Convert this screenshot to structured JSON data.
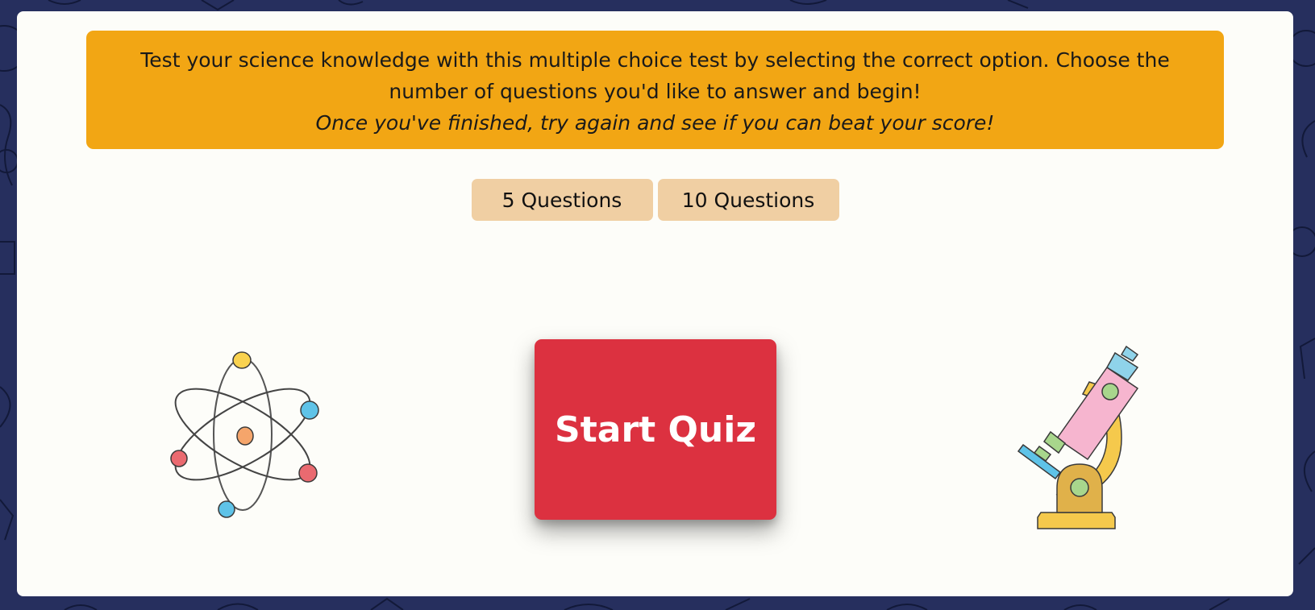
{
  "intro": {
    "line1": "Test your science knowledge with this multiple choice test by selecting the correct option. Choose the number of questions you'd like to answer and begin!",
    "line2": "Once you've finished, try again and see if you can beat your score!"
  },
  "question_options": [
    {
      "label": "5 Questions"
    },
    {
      "label": "10 Questions"
    }
  ],
  "start_button": {
    "label": "Start Quiz"
  },
  "illustrations": {
    "left": "atom-icon",
    "right": "microscope-icon"
  },
  "colors": {
    "page_background": "#262f5e",
    "card_background": "#fdfdf9",
    "intro_banner": "#f2a614",
    "option_button": "#f0cfa3",
    "start_button": "#dc3140"
  }
}
